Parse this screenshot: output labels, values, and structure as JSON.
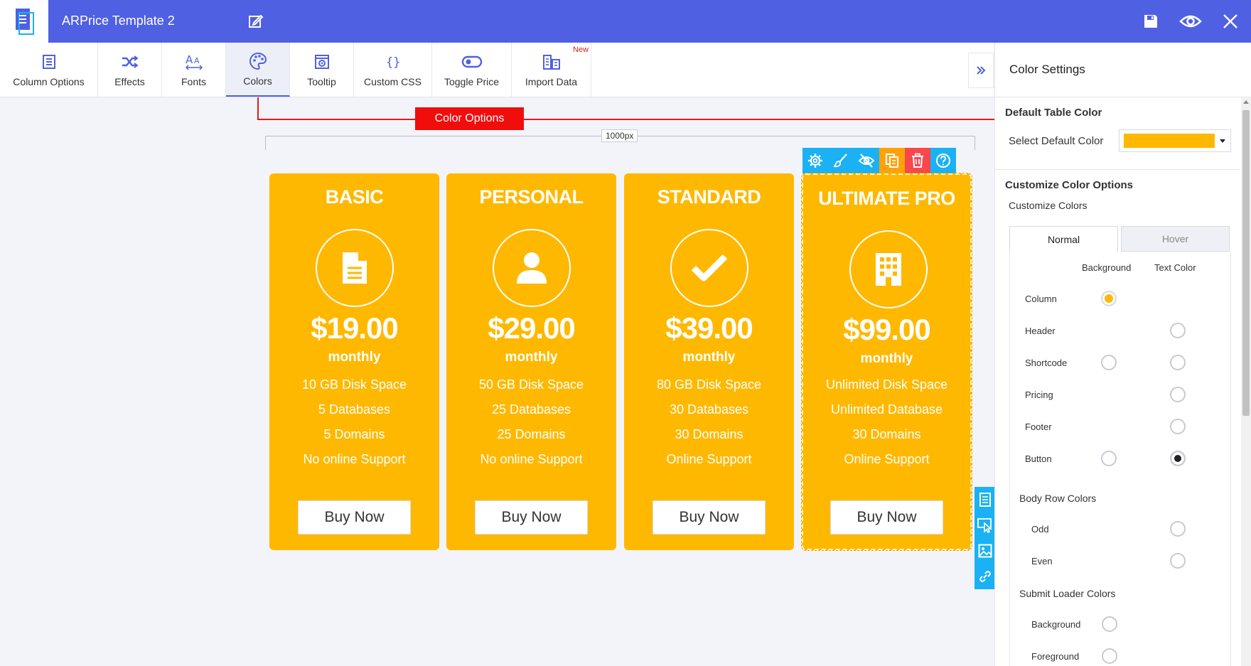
{
  "app": {
    "title": "ARPrice Template 2"
  },
  "toolbar": {
    "items": [
      {
        "label": "Column Options",
        "icon": "column-options-icon"
      },
      {
        "label": "Effects",
        "icon": "shuffle-icon"
      },
      {
        "label": "Fonts",
        "icon": "font-icon"
      },
      {
        "label": "Colors",
        "icon": "palette-icon",
        "active": true
      },
      {
        "label": "Tooltip",
        "icon": "tooltip-icon"
      },
      {
        "label": "Custom CSS",
        "icon": "braces-icon"
      },
      {
        "label": "Toggle Price",
        "icon": "toggle-icon"
      },
      {
        "label": "Import Data",
        "icon": "import-icon",
        "badge": "New"
      }
    ]
  },
  "callout": {
    "label": "Color Options",
    "color": "#f20d0d"
  },
  "ruler": {
    "label": "1000px"
  },
  "colors": {
    "brand": "#4f60e2",
    "card": "#ffb800",
    "accent": "#1ab1f5"
  },
  "cards": [
    {
      "title": "BASIC",
      "icon": "document-icon",
      "price": "$19.00",
      "period": "monthly",
      "features": [
        "10 GB Disk Space",
        "5 Databases",
        "5 Domains",
        "No online Support"
      ],
      "button": "Buy Now"
    },
    {
      "title": "PERSONAL",
      "icon": "user-icon",
      "price": "$29.00",
      "period": "monthly",
      "features": [
        "50 GB Disk Space",
        "25 Databases",
        "25 Domains",
        "No online Support"
      ],
      "button": "Buy Now"
    },
    {
      "title": "STANDARD",
      "icon": "checkmark-icon",
      "price": "$39.00",
      "period": "monthly",
      "features": [
        "80 GB Disk Space",
        "30 Databases",
        "30 Domains",
        "Online Support"
      ],
      "button": "Buy Now"
    },
    {
      "title": "ULTIMATE PRO",
      "icon": "building-icon",
      "price": "$99.00",
      "period": "monthly",
      "features": [
        "Unlimited Disk Space",
        "Unlimited Database",
        "30 Domains",
        "Online Support"
      ],
      "button": "Buy Now"
    }
  ],
  "panel": {
    "title": "Color Settings",
    "default_section": "Default Table Color",
    "select_default_label": "Select Default Color",
    "default_color": "#ffb800",
    "customize_section": "Customize Color Options",
    "customize_label": "Customize Colors",
    "tabs": [
      "Normal",
      "Hover"
    ],
    "col_background": "Background",
    "col_text": "Text Color",
    "rows": [
      "Column",
      "Header",
      "Shortcode",
      "Pricing",
      "Footer",
      "Button"
    ],
    "body_row_title": "Body Row Colors",
    "body_rows": [
      "Odd",
      "Even"
    ],
    "loader_title": "Submit Loader Colors",
    "loader_rows": [
      "Background",
      "Foreground"
    ]
  }
}
